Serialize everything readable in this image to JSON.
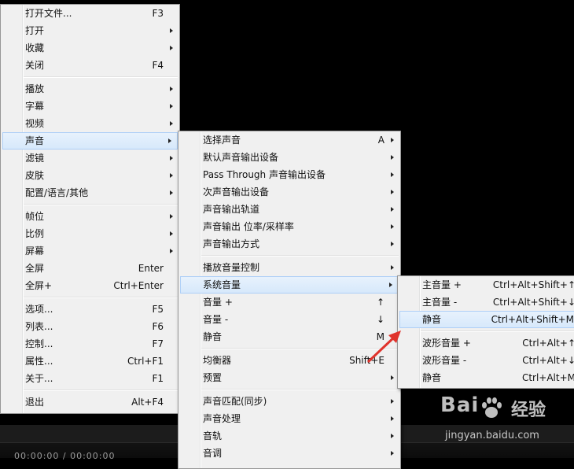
{
  "menu1": [
    {
      "type": "item",
      "label": "打开文件...",
      "shortcut": "F3",
      "arrow": false
    },
    {
      "type": "item",
      "label": "打开",
      "shortcut": "",
      "arrow": true
    },
    {
      "type": "item",
      "label": "收藏",
      "shortcut": "",
      "arrow": true
    },
    {
      "type": "item",
      "label": "关闭",
      "shortcut": "F4",
      "arrow": false
    },
    {
      "type": "sep"
    },
    {
      "type": "item",
      "label": "播放",
      "shortcut": "",
      "arrow": true
    },
    {
      "type": "item",
      "label": "字幕",
      "shortcut": "",
      "arrow": true
    },
    {
      "type": "item",
      "label": "视频",
      "shortcut": "",
      "arrow": true
    },
    {
      "type": "item",
      "label": "声音",
      "shortcut": "",
      "arrow": true,
      "highlight": true
    },
    {
      "type": "item",
      "label": "滤镜",
      "shortcut": "",
      "arrow": true
    },
    {
      "type": "item",
      "label": "皮肤",
      "shortcut": "",
      "arrow": true
    },
    {
      "type": "item",
      "label": "配置/语言/其他",
      "shortcut": "",
      "arrow": true
    },
    {
      "type": "sep"
    },
    {
      "type": "item",
      "label": "帧位",
      "shortcut": "",
      "arrow": true
    },
    {
      "type": "item",
      "label": "比例",
      "shortcut": "",
      "arrow": true
    },
    {
      "type": "item",
      "label": "屏幕",
      "shortcut": "",
      "arrow": true
    },
    {
      "type": "item",
      "label": "全屏",
      "shortcut": "Enter",
      "arrow": false
    },
    {
      "type": "item",
      "label": "全屏+",
      "shortcut": "Ctrl+Enter",
      "arrow": false
    },
    {
      "type": "sep"
    },
    {
      "type": "item",
      "label": "选项...",
      "shortcut": "F5",
      "arrow": false
    },
    {
      "type": "item",
      "label": "列表...",
      "shortcut": "F6",
      "arrow": false
    },
    {
      "type": "item",
      "label": "控制...",
      "shortcut": "F7",
      "arrow": false
    },
    {
      "type": "item",
      "label": "属性...",
      "shortcut": "Ctrl+F1",
      "arrow": false
    },
    {
      "type": "item",
      "label": "关于...",
      "shortcut": "F1",
      "arrow": false
    },
    {
      "type": "sep"
    },
    {
      "type": "item",
      "label": "退出",
      "shortcut": "Alt+F4",
      "arrow": false
    }
  ],
  "menu2": [
    {
      "type": "item",
      "label": "选择声音",
      "shortcut": "A",
      "arrow": true
    },
    {
      "type": "item",
      "label": "默认声音输出设备",
      "shortcut": "",
      "arrow": true
    },
    {
      "type": "item",
      "label": "Pass Through 声音输出设备",
      "shortcut": "",
      "arrow": true
    },
    {
      "type": "item",
      "label": "次声音输出设备",
      "shortcut": "",
      "arrow": true
    },
    {
      "type": "item",
      "label": "声音输出轨道",
      "shortcut": "",
      "arrow": true
    },
    {
      "type": "item",
      "label": "声音输出 位率/采样率",
      "shortcut": "",
      "arrow": true
    },
    {
      "type": "item",
      "label": "声音输出方式",
      "shortcut": "",
      "arrow": true
    },
    {
      "type": "sep"
    },
    {
      "type": "item",
      "label": "播放音量控制",
      "shortcut": "",
      "arrow": true
    },
    {
      "type": "item",
      "label": "系统音量",
      "shortcut": "",
      "arrow": true,
      "highlight": true
    },
    {
      "type": "item",
      "label": "音量 +",
      "shortcut": "↑",
      "arrow": false
    },
    {
      "type": "item",
      "label": "音量 -",
      "shortcut": "↓",
      "arrow": false
    },
    {
      "type": "item",
      "label": "静音",
      "shortcut": "M",
      "arrow": false
    },
    {
      "type": "sep"
    },
    {
      "type": "item",
      "label": "均衡器",
      "shortcut": "Shift+E",
      "arrow": false
    },
    {
      "type": "item",
      "label": "预置",
      "shortcut": "",
      "arrow": true
    },
    {
      "type": "sep"
    },
    {
      "type": "item",
      "label": "声音匹配(同步)",
      "shortcut": "",
      "arrow": true
    },
    {
      "type": "item",
      "label": "声音处理",
      "shortcut": "",
      "arrow": true
    },
    {
      "type": "item",
      "label": "音轨",
      "shortcut": "",
      "arrow": true
    },
    {
      "type": "item",
      "label": "音调",
      "shortcut": "",
      "arrow": true
    }
  ],
  "menu3": [
    {
      "type": "item",
      "label": "主音量 +",
      "shortcut": "Ctrl+Alt+Shift+↑",
      "arrow": false
    },
    {
      "type": "item",
      "label": "主音量 -",
      "shortcut": "Ctrl+Alt+Shift+↓",
      "arrow": false
    },
    {
      "type": "item",
      "label": "静音",
      "shortcut": "Ctrl+Alt+Shift+M",
      "arrow": false,
      "highlight": true
    },
    {
      "type": "sep"
    },
    {
      "type": "item",
      "label": "波形音量 +",
      "shortcut": "Ctrl+Alt+↑",
      "arrow": false
    },
    {
      "type": "item",
      "label": "波形音量 -",
      "shortcut": "Ctrl+Alt+↓",
      "arrow": false
    },
    {
      "type": "item",
      "label": "静音",
      "shortcut": "Ctrl+Alt+M",
      "arrow": false
    }
  ],
  "player": {
    "time": "00:00:00 / 00:00:00"
  },
  "watermark": {
    "logo": "Bai",
    "brand": "经验",
    "url": "jingyan.baidu.com"
  }
}
